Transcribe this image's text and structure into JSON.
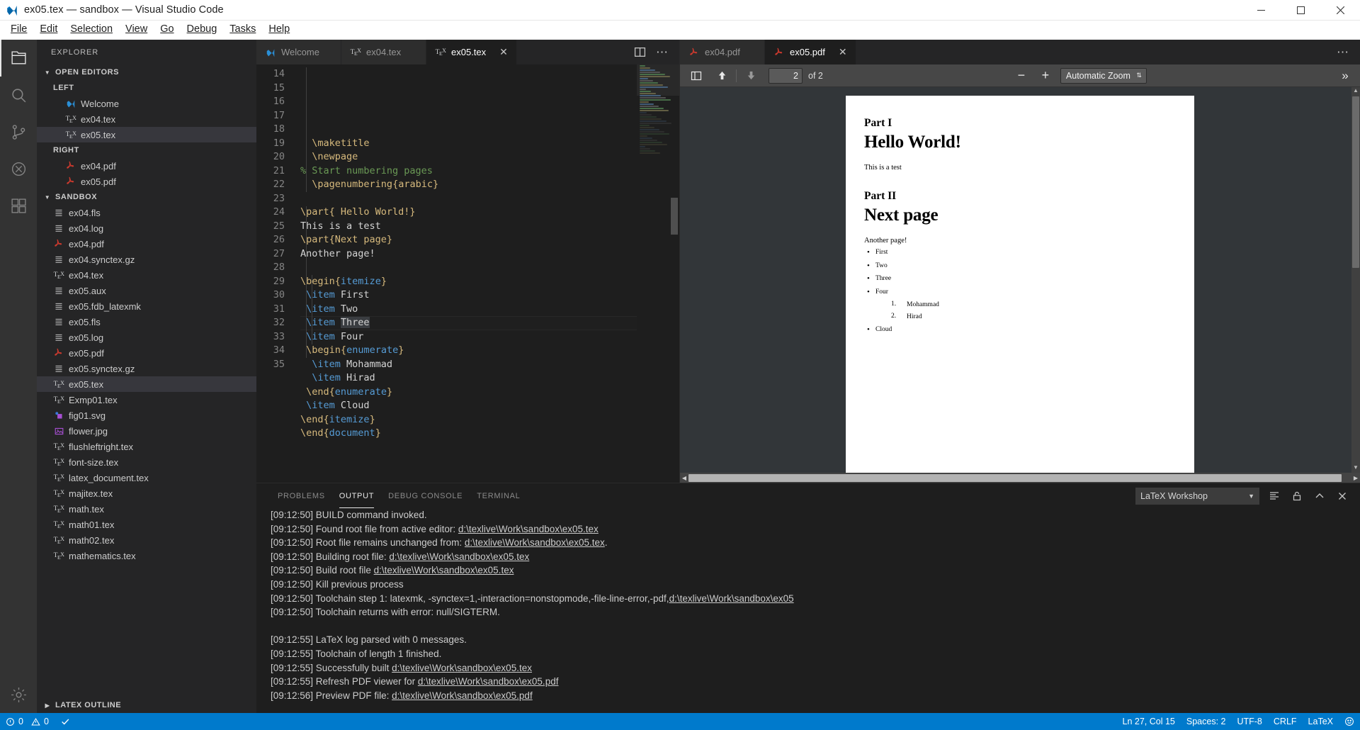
{
  "window": {
    "title": "ex05.tex — sandbox — Visual Studio Code",
    "minimize": "—",
    "maximize": "▢",
    "close": "✕"
  },
  "menubar": [
    {
      "label": "File"
    },
    {
      "label": "Edit"
    },
    {
      "label": "Selection"
    },
    {
      "label": "View"
    },
    {
      "label": "Go"
    },
    {
      "label": "Debug"
    },
    {
      "label": "Tasks"
    },
    {
      "label": "Help"
    }
  ],
  "activitybar": [
    {
      "name": "explorer-icon",
      "title": "Explorer"
    },
    {
      "name": "search-icon",
      "title": "Search"
    },
    {
      "name": "source-control-icon",
      "title": "Source Control"
    },
    {
      "name": "debug-icon",
      "title": "Debug"
    },
    {
      "name": "extensions-icon",
      "title": "Extensions"
    },
    {
      "name": "settings-gear-icon",
      "title": "Manage"
    }
  ],
  "sidebar": {
    "title": "EXPLORER",
    "open_editors": {
      "label": "OPEN EDITORS",
      "groups": [
        {
          "label": "LEFT",
          "items": [
            {
              "label": "Welcome",
              "icon": "vscode-icon",
              "selected": false
            },
            {
              "label": "ex04.tex",
              "icon": "tex-icon",
              "selected": false
            },
            {
              "label": "ex05.tex",
              "icon": "tex-icon",
              "selected": true
            }
          ]
        },
        {
          "label": "RIGHT",
          "items": [
            {
              "label": "ex04.pdf",
              "icon": "pdf-icon",
              "selected": false
            },
            {
              "label": "ex05.pdf",
              "icon": "pdf-icon",
              "selected": false
            }
          ]
        }
      ]
    },
    "workspace": {
      "label": "SANDBOX",
      "files": [
        {
          "label": "ex04.fls",
          "icon": "file-lines-icon",
          "selected": false
        },
        {
          "label": "ex04.log",
          "icon": "file-lines-icon",
          "selected": false
        },
        {
          "label": "ex04.pdf",
          "icon": "pdf-icon",
          "selected": false
        },
        {
          "label": "ex04.synctex.gz",
          "icon": "file-lines-icon",
          "selected": false
        },
        {
          "label": "ex04.tex",
          "icon": "tex-icon",
          "selected": false
        },
        {
          "label": "ex05.aux",
          "icon": "file-lines-icon",
          "selected": false
        },
        {
          "label": "ex05.fdb_latexmk",
          "icon": "file-lines-icon",
          "selected": false
        },
        {
          "label": "ex05.fls",
          "icon": "file-lines-icon",
          "selected": false
        },
        {
          "label": "ex05.log",
          "icon": "file-lines-icon",
          "selected": false
        },
        {
          "label": "ex05.pdf",
          "icon": "pdf-icon",
          "selected": false
        },
        {
          "label": "ex05.synctex.gz",
          "icon": "file-lines-icon",
          "selected": false
        },
        {
          "label": "ex05.tex",
          "icon": "tex-icon",
          "selected": true
        },
        {
          "label": "Exmp01.tex",
          "icon": "tex-icon",
          "selected": false
        },
        {
          "label": "fig01.svg",
          "icon": "svg-icon",
          "selected": false
        },
        {
          "label": "flower.jpg",
          "icon": "image-icon",
          "selected": false
        },
        {
          "label": "flushleftright.tex",
          "icon": "tex-icon",
          "selected": false
        },
        {
          "label": "font-size.tex",
          "icon": "tex-icon",
          "selected": false
        },
        {
          "label": "latex_document.tex",
          "icon": "tex-icon",
          "selected": false
        },
        {
          "label": "majitex.tex",
          "icon": "tex-icon",
          "selected": false
        },
        {
          "label": "math.tex",
          "icon": "tex-icon",
          "selected": false
        },
        {
          "label": "math01.tex",
          "icon": "tex-icon",
          "selected": false
        },
        {
          "label": "math02.tex",
          "icon": "tex-icon",
          "selected": false
        },
        {
          "label": "mathematics.tex",
          "icon": "tex-icon",
          "selected": false
        }
      ]
    },
    "outline": {
      "label": "LATEX OUTLINE"
    }
  },
  "editor_left": {
    "tabs": [
      {
        "label": "Welcome",
        "icon": "vscode-icon",
        "active": false
      },
      {
        "label": "ex04.tex",
        "icon": "tex-icon",
        "active": false
      },
      {
        "label": "ex05.tex",
        "icon": "tex-icon",
        "active": true
      }
    ],
    "actions": [
      {
        "name": "split-editor-icon"
      },
      {
        "name": "more-actions-icon",
        "label": "⋯"
      }
    ],
    "first_line_number": 14,
    "lines": [
      {
        "n": 14,
        "tokens": [
          {
            "t": "  ",
            "c": "txt"
          },
          {
            "t": "\\maketitle",
            "c": "cmd"
          }
        ]
      },
      {
        "n": 15,
        "tokens": [
          {
            "t": "  ",
            "c": "txt"
          },
          {
            "t": "\\newpage",
            "c": "cmd"
          }
        ]
      },
      {
        "n": 16,
        "tokens": [
          {
            "t": "% Start numbering pages",
            "c": "com"
          }
        ]
      },
      {
        "n": 17,
        "tokens": [
          {
            "t": "  ",
            "c": "txt"
          },
          {
            "t": "\\pagenumbering",
            "c": "cmd"
          },
          {
            "t": "{arabic}",
            "c": "brc"
          }
        ]
      },
      {
        "n": 18,
        "tokens": []
      },
      {
        "n": 19,
        "tokens": [
          {
            "t": "\\part",
            "c": "cmd"
          },
          {
            "t": "{ Hello World!}",
            "c": "brc"
          }
        ]
      },
      {
        "n": 20,
        "tokens": [
          {
            "t": "This is a test",
            "c": "txt"
          }
        ]
      },
      {
        "n": 21,
        "tokens": [
          {
            "t": "\\part",
            "c": "cmd"
          },
          {
            "t": "{Next page}",
            "c": "brc"
          }
        ]
      },
      {
        "n": 22,
        "tokens": [
          {
            "t": "Another page!",
            "c": "txt"
          }
        ]
      },
      {
        "n": 23,
        "tokens": []
      },
      {
        "n": 24,
        "tokens": [
          {
            "t": "\\begin",
            "c": "cmd"
          },
          {
            "t": "{",
            "c": "brc"
          },
          {
            "t": "itemize",
            "c": "env"
          },
          {
            "t": "}",
            "c": "brc"
          }
        ]
      },
      {
        "n": 25,
        "tokens": [
          {
            "t": " ",
            "c": "txt"
          },
          {
            "t": "\\item",
            "c": "itm"
          },
          {
            "t": " First",
            "c": "txt"
          }
        ]
      },
      {
        "n": 26,
        "tokens": [
          {
            "t": " ",
            "c": "txt"
          },
          {
            "t": "\\item",
            "c": "itm"
          },
          {
            "t": " Two",
            "c": "txt"
          }
        ]
      },
      {
        "n": 27,
        "current": true,
        "tokens": [
          {
            "t": " ",
            "c": "txt"
          },
          {
            "t": "\\item",
            "c": "itm"
          },
          {
            "t": " ",
            "c": "txt"
          },
          {
            "t": "Three",
            "c": "txt sel"
          }
        ]
      },
      {
        "n": 28,
        "tokens": [
          {
            "t": " ",
            "c": "txt"
          },
          {
            "t": "\\item",
            "c": "itm"
          },
          {
            "t": " Four",
            "c": "txt"
          }
        ]
      },
      {
        "n": 29,
        "tokens": [
          {
            "t": " ",
            "c": "txt"
          },
          {
            "t": "\\begin",
            "c": "cmd"
          },
          {
            "t": "{",
            "c": "brc"
          },
          {
            "t": "enumerate",
            "c": "env"
          },
          {
            "t": "}",
            "c": "brc"
          }
        ]
      },
      {
        "n": 30,
        "tokens": [
          {
            "t": "  ",
            "c": "txt"
          },
          {
            "t": "\\item",
            "c": "itm"
          },
          {
            "t": " Mohammad",
            "c": "txt"
          }
        ]
      },
      {
        "n": 31,
        "tokens": [
          {
            "t": "  ",
            "c": "txt"
          },
          {
            "t": "\\item",
            "c": "itm"
          },
          {
            "t": " Hirad",
            "c": "txt"
          }
        ]
      },
      {
        "n": 32,
        "tokens": [
          {
            "t": " ",
            "c": "txt"
          },
          {
            "t": "\\end",
            "c": "cmd"
          },
          {
            "t": "{",
            "c": "brc"
          },
          {
            "t": "enumerate",
            "c": "env"
          },
          {
            "t": "}",
            "c": "brc"
          }
        ]
      },
      {
        "n": 33,
        "tokens": [
          {
            "t": " ",
            "c": "txt"
          },
          {
            "t": "\\item",
            "c": "itm"
          },
          {
            "t": " Cloud",
            "c": "txt"
          }
        ]
      },
      {
        "n": 34,
        "tokens": [
          {
            "t": "\\end",
            "c": "cmd"
          },
          {
            "t": "{",
            "c": "brc"
          },
          {
            "t": "itemize",
            "c": "env"
          },
          {
            "t": "}",
            "c": "brc"
          }
        ]
      },
      {
        "n": 35,
        "tokens": [
          {
            "t": "\\end",
            "c": "cmd"
          },
          {
            "t": "{",
            "c": "brc"
          },
          {
            "t": "document",
            "c": "env"
          },
          {
            "t": "}",
            "c": "brc"
          }
        ]
      }
    ]
  },
  "editor_right": {
    "tabs": [
      {
        "label": "ex04.pdf",
        "icon": "pdf-icon",
        "active": false
      },
      {
        "label": "ex05.pdf",
        "icon": "pdf-icon",
        "active": true
      }
    ],
    "actions": [
      {
        "name": "more-actions-icon",
        "label": "⋯"
      }
    ],
    "pdf_toolbar": {
      "sidebar_toggle": "sidebar-toggle-icon",
      "prev_page": "arrow-up-icon",
      "next_page": "arrow-down-icon",
      "page_value": "2",
      "page_of": "of 2",
      "zoom_out": "−",
      "zoom_in": "+",
      "zoom_value": "Automatic Zoom",
      "more_tools": "»"
    },
    "pdf_page": {
      "part1_label": "Part I",
      "part1_title": "Hello World!",
      "part1_body": "This is a test",
      "part2_label": "Part II",
      "part2_title": "Next page",
      "part2_body": "Another page!",
      "items": [
        "First",
        "Two",
        "Three",
        "Four"
      ],
      "subitems": [
        {
          "num": "1.",
          "label": "Mohammad"
        },
        {
          "num": "2.",
          "label": "Hirad"
        }
      ],
      "last_item": "Cloud"
    }
  },
  "panel": {
    "tabs": [
      {
        "label": "PROBLEMS",
        "active": false
      },
      {
        "label": "OUTPUT",
        "active": true
      },
      {
        "label": "DEBUG CONSOLE",
        "active": false
      },
      {
        "label": "TERMINAL",
        "active": false
      }
    ],
    "channel": "LaTeX Workshop",
    "actions": [
      {
        "name": "clear-output-icon"
      },
      {
        "name": "lock-panel-icon"
      },
      {
        "name": "maximize-panel-icon"
      },
      {
        "name": "close-panel-icon"
      }
    ],
    "output_lines": [
      {
        "pre": "[09:12:50] BUILD command invoked.",
        "link": "",
        "post": ""
      },
      {
        "pre": "[09:12:50] Found root file from active editor: ",
        "link": "d:\\texlive\\Work\\sandbox\\ex05.tex",
        "post": ""
      },
      {
        "pre": "[09:12:50] Root file remains unchanged from: ",
        "link": "d:\\texlive\\Work\\sandbox\\ex05.tex",
        "post": "."
      },
      {
        "pre": "[09:12:50] Building root file: ",
        "link": "d:\\texlive\\Work\\sandbox\\ex05.tex",
        "post": ""
      },
      {
        "pre": "[09:12:50] Build root file ",
        "link": "d:\\texlive\\Work\\sandbox\\ex05.tex",
        "post": ""
      },
      {
        "pre": "[09:12:50] Kill previous process",
        "link": "",
        "post": ""
      },
      {
        "pre": "[09:12:50] Toolchain step 1: latexmk, -synctex=1,-interaction=nonstopmode,-file-line-error,-pdf,",
        "link": "d:\\texlive\\Work\\sandbox\\ex05",
        "post": ""
      },
      {
        "pre": "[09:12:50] Toolchain returns with error: null/SIGTERM.",
        "link": "",
        "post": ""
      },
      {
        "pre": "",
        "link": "",
        "post": ""
      },
      {
        "pre": "[09:12:55] LaTeX log parsed with 0 messages.",
        "link": "",
        "post": ""
      },
      {
        "pre": "[09:12:55] Toolchain of length 1 finished.",
        "link": "",
        "post": ""
      },
      {
        "pre": "[09:12:55] Successfully built ",
        "link": "d:\\texlive\\Work\\sandbox\\ex05.tex",
        "post": ""
      },
      {
        "pre": "[09:12:55] Refresh PDF viewer for ",
        "link": "d:\\texlive\\Work\\sandbox\\ex05.pdf",
        "post": ""
      },
      {
        "pre": "[09:12:56] Preview PDF file: ",
        "link": "d:\\texlive\\Work\\sandbox\\ex05.pdf",
        "post": ""
      }
    ]
  },
  "statusbar": {
    "errors": "0",
    "warnings": "0",
    "build_icon": "check-icon",
    "position": "Ln 27, Col 15",
    "spaces": "Spaces: 2",
    "encoding": "UTF-8",
    "eol": "CRLF",
    "language": "LaTeX",
    "feedback_icon": "smiley-icon",
    "accent_color": "#007acc"
  }
}
